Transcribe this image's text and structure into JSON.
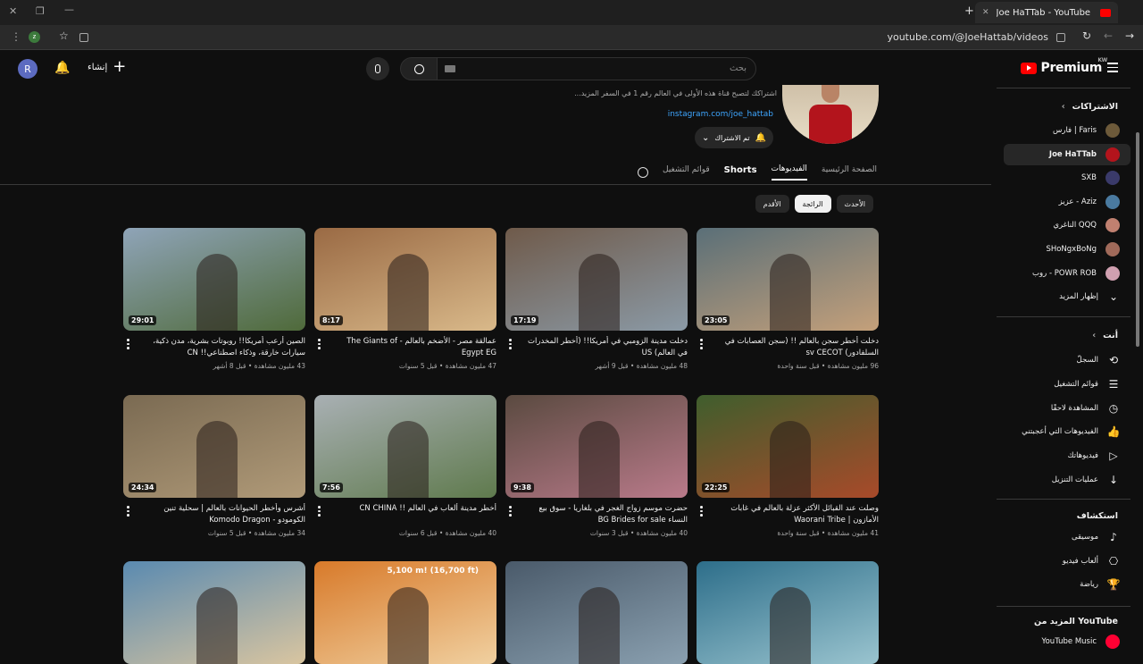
{
  "browser": {
    "tab_title": "Joe HaTTab - YouTube",
    "url": "youtube.com/@JoeHattab/videos"
  },
  "topbar": {
    "avatar_letter": "R",
    "create_label": "إنشاء",
    "search_placeholder": "بحث",
    "logo_text": "Premium",
    "logo_region": "KW"
  },
  "channel": {
    "description": "اشتراكك لتصبح قناة هذه الأولى في العالم رقم 1 في السفر المزيد...",
    "link": "instagram.com/joe_hattab",
    "subscribed_label": "تم الاشتراك"
  },
  "tabs": [
    {
      "label": "الصفحة الرئيسية"
    },
    {
      "label": "الفيديوهات",
      "active": true
    },
    {
      "label": "Shorts"
    },
    {
      "label": "قوائم التشغيل"
    }
  ],
  "chips": [
    {
      "label": "الأحدث"
    },
    {
      "label": "الرائجة",
      "selected": true
    },
    {
      "label": "الأقدم"
    }
  ],
  "videos": [
    {
      "title": "دخلت أخطر سجن بالعالم !! (سجن العصابات في السلفادور) sv CECOT",
      "meta": "96 مليون مشاهدة • قبل سنة واحدة",
      "duration": "23:05",
      "c1": "#5a6f78",
      "c2": "#c4a07a"
    },
    {
      "title": "دخلت مدينة الزومبي في أمريكا!! (أخطر المخدرات في العالم) US",
      "meta": "48 مليون مشاهدة • قبل 9 أشهر",
      "duration": "17:19",
      "c1": "#6f5a4a",
      "c2": "#8b9aa6"
    },
    {
      "title": "عمالقة مصر - الأضخم بالعالم - The Giants of Egypt EG",
      "meta": "47 مليون مشاهدة • قبل 5 سنوات",
      "duration": "8:17",
      "c1": "#9a6a44",
      "c2": "#d9b98a"
    },
    {
      "title": "الصين أرعب أمريكا!! روبوتات بشرية، مدن ذكية، سيارات خارقة، وذكاء اصطناعي!! CN",
      "meta": "43 مليون مشاهدة • قبل 8 أشهر",
      "duration": "29:01",
      "c1": "#8fa4b8",
      "c2": "#4f6a3a"
    },
    {
      "title": "وصلت عند القبائل الأكثر عزلة بالعالم في غابات الأمازون | Waorani Tribe",
      "meta": "41 مليون مشاهدة • قبل سنة واحدة",
      "duration": "22:25",
      "c1": "#3f5e2d",
      "c2": "#a84a2a"
    },
    {
      "title": "حضرت موسم زواج الغجر في بلغاريا - سوق بيع النساء BG Brides for sale",
      "meta": "40 مليون مشاهدة • قبل 3 سنوات",
      "duration": "9:38",
      "c1": "#5a4a40",
      "c2": "#b97a8a"
    },
    {
      "title": "أخطر مدينة ألعاب في العالم !! CN CHINA",
      "meta": "40 مليون مشاهدة • قبل 6 سنوات",
      "duration": "7:56",
      "c1": "#a9b0b4",
      "c2": "#5f7a4d"
    },
    {
      "title": "أشرس وأخطر الحيوانات بالعالم | سحلية تنين الكومودو - Komodo Dragon",
      "meta": "34 مليون مشاهدة • قبل 5 سنوات",
      "duration": "24:34",
      "c1": "#7a6a52",
      "c2": "#b09a78"
    },
    {
      "title": "",
      "meta": "",
      "duration": "",
      "c1": "#2d6e8a",
      "c2": "#9ac4cf"
    },
    {
      "title": "",
      "meta": "",
      "duration": "",
      "c1": "#4a5a6a",
      "c2": "#8aa0b0"
    },
    {
      "title": "",
      "meta": "",
      "duration": "",
      "c1": "#d87a2a",
      "c2": "#f0d0a0"
    },
    {
      "title": "",
      "meta": "",
      "duration": "",
      "c1": "#5a8ab0",
      "c2": "#d9c5a0"
    }
  ],
  "row3_thumb_text": "5,100 m! (16,700 ft)",
  "sidebar": {
    "subs_header": "الاشتراكات",
    "subs": [
      {
        "label": "فارس | Faris",
        "color": "#6d5a3a"
      },
      {
        "label": "Joe HaTTab",
        "color": "#b3141c",
        "active": true
      },
      {
        "label": "SXB",
        "color": "#3a3a6a"
      },
      {
        "label": "عزيز - Aziz",
        "color": "#4a7aa0"
      },
      {
        "label": "الناغري QQQ",
        "color": "#c08070"
      },
      {
        "label": "SHoNgxBoNg",
        "color": "#a06a5a"
      },
      {
        "label": "روب - POWR ROB",
        "color": "#d0a0b0"
      },
      {
        "label": "إظهار المزيد",
        "color": ""
      }
    ],
    "you_header": "أنت",
    "you": [
      {
        "label": "السجلّ",
        "icon": "history-icon",
        "glyph": "⟲"
      },
      {
        "label": "قوائم التشغيل",
        "icon": "playlists-icon",
        "glyph": "☰"
      },
      {
        "label": "المشاهدة لاحقًا",
        "icon": "watch-later-icon",
        "glyph": "◷"
      },
      {
        "label": "الفيديوهات التي أعجبتني",
        "icon": "like-icon",
        "glyph": "👍"
      },
      {
        "label": "فيديوهاتك",
        "icon": "your-videos-icon",
        "glyph": "▷"
      },
      {
        "label": "عمليات التنزيل",
        "icon": "download-icon",
        "glyph": "↓"
      }
    ],
    "explore_header": "استكشاف",
    "explore": [
      {
        "label": "موسيقى",
        "icon": "music-icon",
        "glyph": "♪"
      },
      {
        "label": "ألعاب فيديو",
        "icon": "gaming-icon",
        "glyph": "⎔"
      },
      {
        "label": "رياضة",
        "icon": "trophy-icon",
        "glyph": "🏆"
      }
    ],
    "more_header": "المزيد من YouTube",
    "more_first": "YouTube Music"
  }
}
